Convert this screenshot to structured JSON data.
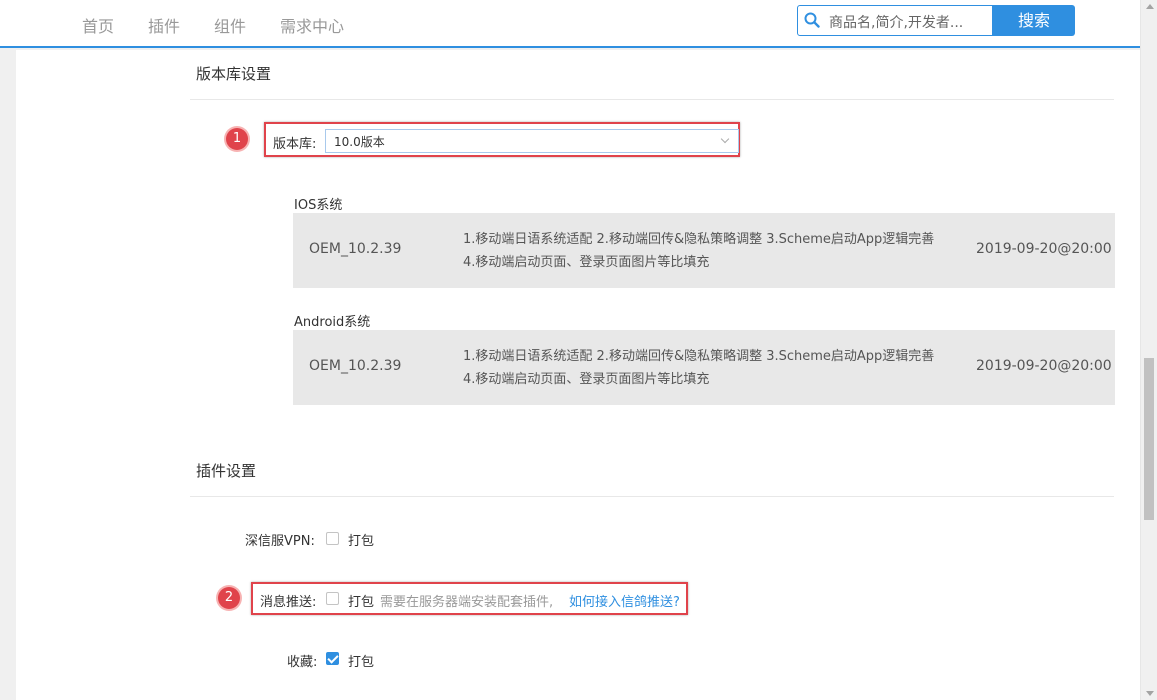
{
  "nav": {
    "items": [
      "首页",
      "插件",
      "组件",
      "需求中心"
    ]
  },
  "search": {
    "placeholder": "商品名,简介,开发者...",
    "button_label": "搜索"
  },
  "repo_section": {
    "title": "版本库设置",
    "badge": "1",
    "label": "版本库:",
    "selected": "10.0版本",
    "releases": [
      {
        "os": "IOS系统",
        "version": "OEM_10.2.39",
        "notes_line1": "1.移动端日语系统适配 2.移动端回传&隐私策略调整 3.Scheme启动App逻辑完善",
        "notes_line2": "4.移动端启动页面、登录页面图片等比填充",
        "date": "2019-09-20@20:00"
      },
      {
        "os": "Android系统",
        "version": "OEM_10.2.39",
        "notes_line1": "1.移动端日语系统适配 2.移动端回传&隐私策略调整 3.Scheme启动App逻辑完善",
        "notes_line2": "4.移动端启动页面、登录页面图片等比填充",
        "date": "2019-09-20@20:00"
      }
    ]
  },
  "plugin_section": {
    "title": "插件设置",
    "badge": "2",
    "vpn": {
      "label": "深信服VPN:",
      "option": "打包",
      "checked": false
    },
    "push": {
      "label": "消息推送:",
      "option": "打包",
      "checked": false,
      "hint": "需要在服务器端安装配套插件,",
      "link": "如何接入信鸽推送?"
    },
    "favorite": {
      "label": "收藏:",
      "option": "打包",
      "checked": true
    }
  },
  "colors": {
    "accent": "#2f8fe0",
    "annotation": "#e0434b"
  }
}
